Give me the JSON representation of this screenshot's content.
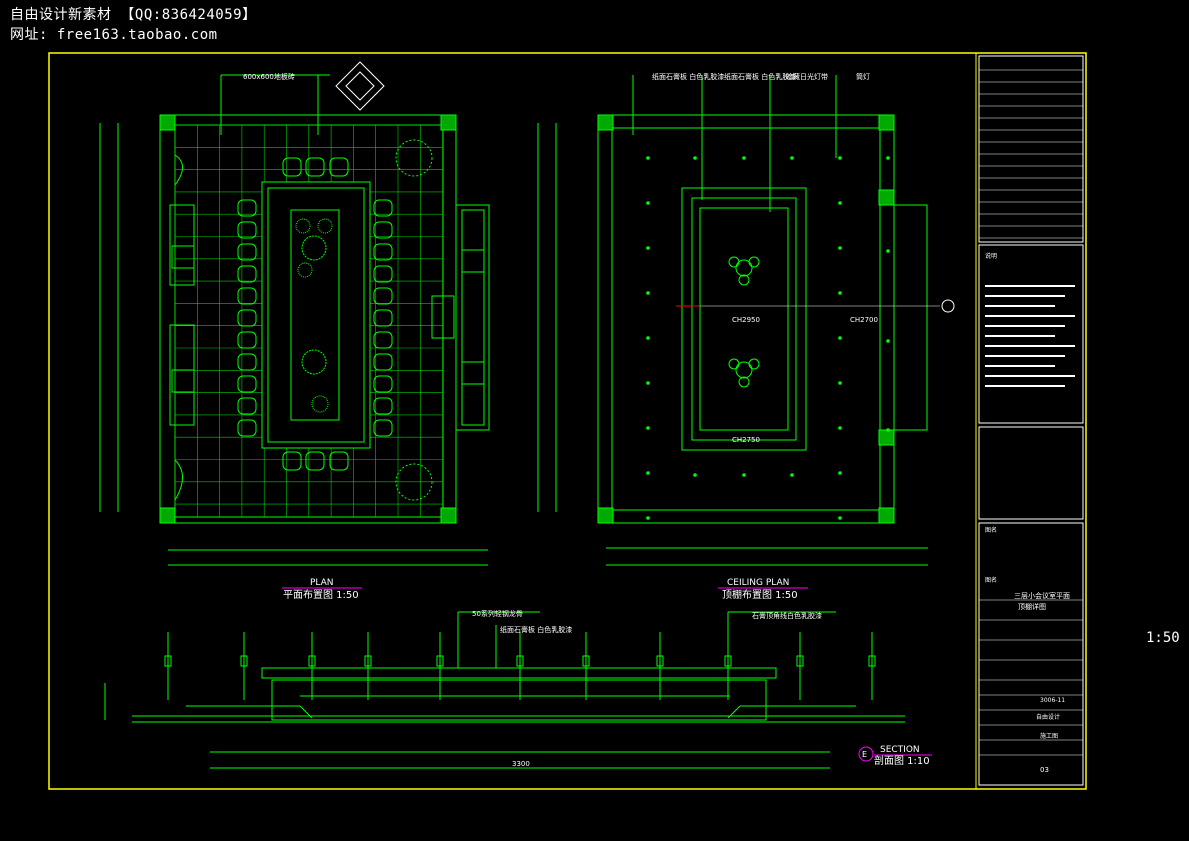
{
  "header": {
    "line1": "自由设计新素材  【QQ:836424059】",
    "line2": "网址: free163.taobao.com"
  },
  "side_scale": "1:50",
  "plan": {
    "title_en": "PLAN",
    "title_cn": "平面布置图 1:50",
    "note_top": "600x600地板砖"
  },
  "ceiling": {
    "title_en": "CEILING PLAN",
    "title_cn": "顶棚布置图 1:50",
    "notes": [
      "纸面石膏板 白色乳胶漆",
      "纸面石膏板 白色乳胶漆",
      "暗藏日光灯带",
      "筒灯"
    ],
    "heights": [
      "CH2950",
      "CH2700",
      "CH2750"
    ]
  },
  "section": {
    "tag": "E",
    "title_en": "SECTION",
    "title_cn": "剖面图 1:10",
    "notes": [
      "50系列轻钢龙骨",
      "纸面石膏板 白色乳胶漆",
      "石膏顶角线白色乳胶漆"
    ],
    "dims": [
      "3300"
    ]
  },
  "title_block": {
    "notes_header": "说明",
    "project_label": "图名",
    "drawing_name_line1": "三层小会议室平面",
    "drawing_name_line2": "顶棚详图",
    "drawing_no": "3006-11",
    "designer": "自由设计",
    "stage": "施工图",
    "sheet": "03"
  },
  "colors": {
    "line": "#00ff00",
    "frame": "#ffff00",
    "text": "#ffffff",
    "accent": "#ff0000",
    "cyan": "#00ffff"
  }
}
